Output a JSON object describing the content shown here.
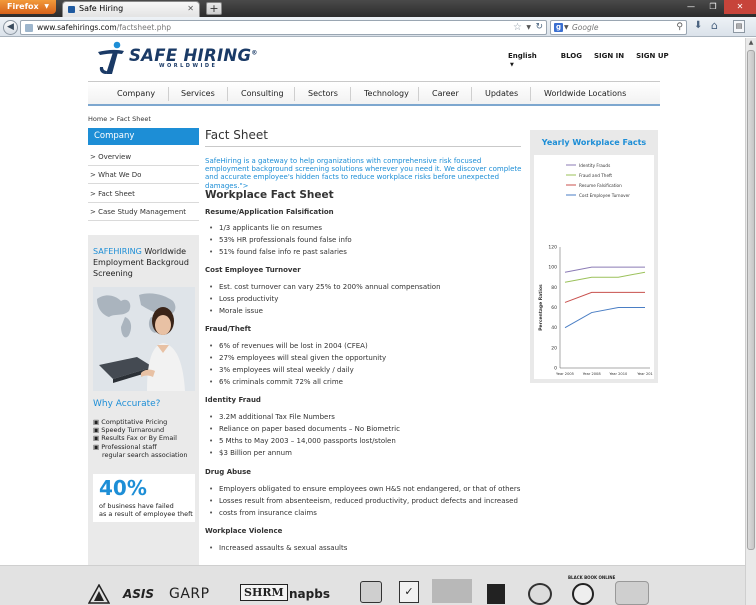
{
  "browser": {
    "app_button": "Firefox",
    "tab_title": "Safe Hiring",
    "url_domain": "www.safehirings.com",
    "url_path": "/factsheet.php",
    "search_placeholder": "Google"
  },
  "header": {
    "logo_text": "SAFE HIRING",
    "logo_reg": "®",
    "logo_sub": "WORLDWIDE",
    "top_links": {
      "language": "English",
      "blog": "BLOG",
      "sign_in": "SIGN IN",
      "sign_up": "SIGN UP"
    }
  },
  "nav": [
    "Company",
    "Services",
    "Consulting",
    "Sectors",
    "Technology",
    "Career",
    "Updates",
    "Worldwide Locations"
  ],
  "breadcrumb": "Home > Fact Sheet",
  "sidebar": {
    "header": "Company",
    "items": [
      "> Overview",
      "> What We Do",
      "> Fact Sheet",
      "> Case Study Management"
    ],
    "promo_brand": "SAFEHIRING",
    "promo_rest": " Worldwide Employment Backgroud Screening",
    "why_title": "Why Accurate?",
    "why_list": [
      "Comptitative Pricing",
      "Speedy Turnaround",
      "Results Fax or By Email",
      "Professional staff",
      "regular search association"
    ],
    "stat_value": "40%",
    "stat_line1": "of business have failed",
    "stat_line2": "as a result of employee theft"
  },
  "main": {
    "title": "Fact Sheet",
    "intro": "SafeHiring is a gateway to help organizations with comprehensive risk focused employment background screening solutions wherever you need it. We discover complete and accurate employee's hidden facts to reduce workplace risks before unexpected damages.\">",
    "subtitle": "Workplace Fact Sheet",
    "sections": [
      {
        "heading": "Resume/Application Falsification",
        "bullets": [
          "1/3 applicants lie on resumes",
          "53% HR professionals found false info",
          "51% found false info re past salaries"
        ]
      },
      {
        "heading": "Cost Employee Turnover",
        "bullets": [
          "Est. cost turnover can vary 25% to 200% annual compensation",
          "Loss productivity",
          "Morale issue"
        ]
      },
      {
        "heading": "Fraud/Theft",
        "bullets": [
          "6% of revenues will be lost in 2004 (CFEA)",
          "27% employees will steal given the opportunity",
          "3% employees will steal weekly / daily",
          "6% criminals commit 72% all crime"
        ]
      },
      {
        "heading": "Identity Fraud",
        "bullets": [
          "3.2M additional Tax File Numbers",
          "Reliance on paper based documents – No Biometric",
          "5 Mths to May 2003 – 14,000 passports lost/stolen",
          "$3 Billion per annum"
        ]
      },
      {
        "heading": "Drug Abuse",
        "bullets": [
          "Employers obligated to ensure employees own H&S not endangered, or that of others",
          "Losses result from absenteeism, reduced productivity, product defects and increased",
          "costs from insurance claims"
        ]
      },
      {
        "heading": "Workplace Violence",
        "bullets": [
          "Increased assaults & sexual assaults"
        ]
      }
    ]
  },
  "chart_panel": {
    "title": "Yearly Workplace Facts"
  },
  "chart_data": {
    "type": "line",
    "title": "",
    "ylabel": "Percentage Ratios",
    "xlabel": "",
    "x": [
      "Year 2005",
      "Year 2008",
      "Year 2010",
      "Year 201"
    ],
    "ylim": [
      0,
      120
    ],
    "yticks": [
      0,
      20,
      40,
      60,
      80,
      100,
      120
    ],
    "grid": false,
    "legend": "top",
    "series": [
      {
        "name": "Identity Frauds",
        "color": "#8b7bb5",
        "values": [
          95,
          100,
          100,
          100
        ]
      },
      {
        "name": "Fraud and Theft",
        "color": "#9bc15a",
        "values": [
          85,
          90,
          90,
          95
        ]
      },
      {
        "name": "Resume Falsification",
        "color": "#c8504d",
        "values": [
          65,
          75,
          75,
          75
        ]
      },
      {
        "name": "Cost Employee Turnover",
        "color": "#4a7ec4",
        "values": [
          40,
          55,
          60,
          60
        ]
      }
    ]
  },
  "footer": {
    "logos": [
      "ASIS",
      "GARP",
      "SHRM",
      "napbs",
      "BLACK BOOK ONLINE"
    ]
  },
  "colors": {
    "accent": "#1d8ed6",
    "brand_dark": "#1a3a66"
  }
}
